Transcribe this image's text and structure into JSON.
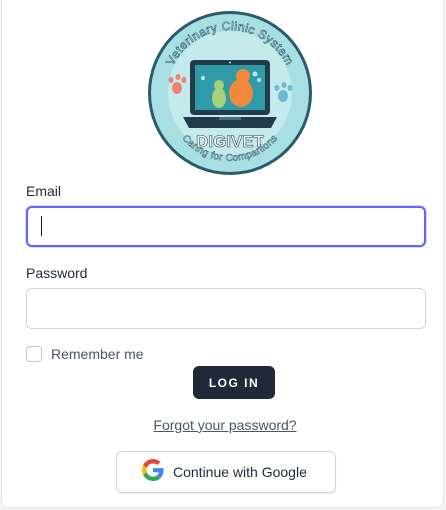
{
  "logo": {
    "name": "DIGIVET",
    "top_text": "Veterinary Clinic System",
    "bottom_text": "Caring for Companions"
  },
  "form": {
    "email_label": "Email",
    "email_value": "",
    "password_label": "Password",
    "password_value": "",
    "remember_label": "Remember me",
    "remember_checked": false,
    "login_label": "LOG IN",
    "forgot_label": "Forgot your password?",
    "google_label": "Continue with Google"
  },
  "colors": {
    "focus_ring": "#6366f1",
    "button_dark": "#1f2937",
    "logo_bg": "#a5dde0",
    "screen": "#2f9aa8"
  },
  "icons": {
    "google": "google-g-icon"
  }
}
